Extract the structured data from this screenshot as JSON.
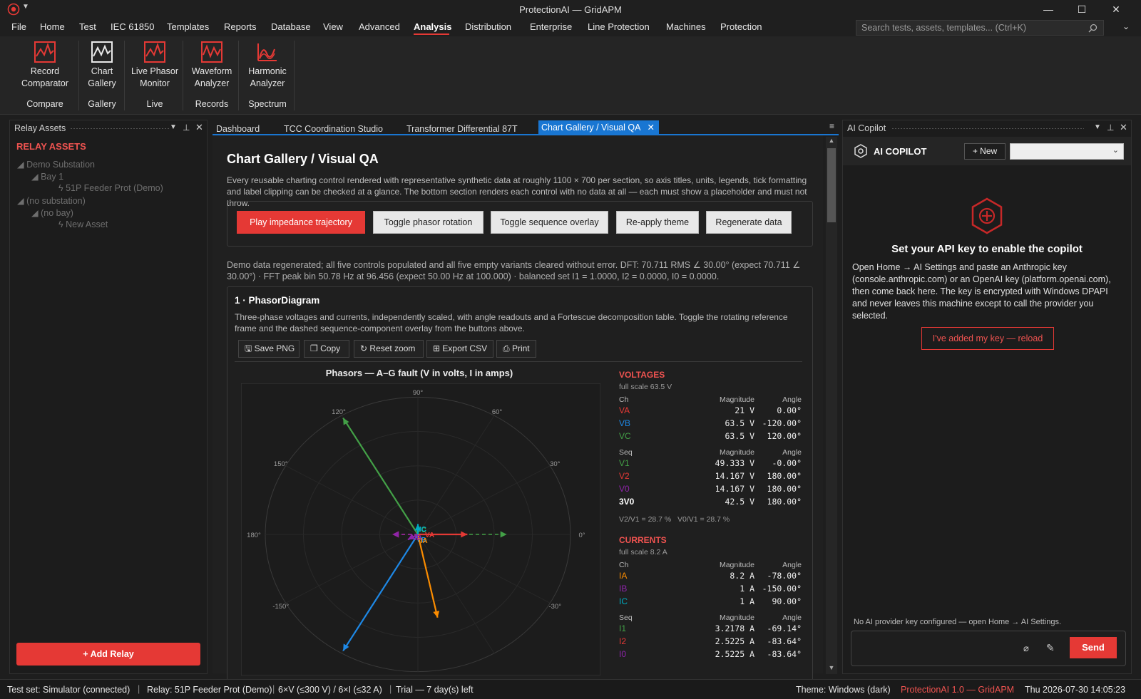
{
  "window": {
    "title": "ProtectionAI — GridAPM"
  },
  "menu": [
    "File",
    "Home",
    "Test",
    "IEC 61850",
    "Templates",
    "Reports",
    "Database",
    "View",
    "Advanced",
    "Analysis",
    "Distribution",
    "Enterprise",
    "Line Protection",
    "Machines",
    "Protection"
  ],
  "search_placeholder": "Search tests, assets, templates... (Ctrl+K)",
  "ribbon": {
    "buttons": [
      {
        "l1": "Record",
        "l2": "Comparator"
      },
      {
        "l1": "Chart",
        "l2": "Gallery"
      },
      {
        "l1": "Live Phasor",
        "l2": "Monitor"
      },
      {
        "l1": "Waveform",
        "l2": "Analyzer"
      },
      {
        "l1": "Harmonic",
        "l2": "Analyzer"
      }
    ],
    "groups": [
      "Compare",
      "Gallery",
      "Live",
      "Records",
      "Spectrum"
    ]
  },
  "left": {
    "title": "Relay Assets",
    "heading": "RELAY ASSETS",
    "tree": [
      "Demo Substation",
      "Bay 1",
      "51P Feeder Prot (Demo)",
      "(no substation)",
      "(no bay)",
      "New Asset"
    ],
    "add": "+ Add Relay"
  },
  "tabs": [
    "Dashboard",
    "TCC Coordination Studio",
    "Transformer Differential 87T",
    "Chart Gallery / Visual QA"
  ],
  "doc": {
    "title": "Chart Gallery / Visual QA",
    "desc": "Every reusable charting control rendered with representative synthetic data at roughly 1100 × 700 per section, so axis titles, units, legends, tick formatting and label clipping can be checked at a glance. The bottom section renders each control with no data at all — each must show a placeholder and must not throw.",
    "buttons": [
      "Play impedance trajectory",
      "Toggle phasor rotation",
      "Toggle sequence overlay",
      "Re-apply theme",
      "Regenerate data"
    ],
    "status": "Demo data regenerated; all five controls populated and all five empty variants cleared without error.  DFT: 70.711 RMS ∠ 30.00° (expect 70.711 ∠ 30.00°) · FFT peak bin 50.78 Hz at 96.456 (expect 50.00 Hz at 100.000) · balanced set I1 = 1.0000, I2 = 0.0000, I0 = 0.0000.",
    "section_title": "1 · PhasorDiagram",
    "section_desc": "Three-phase voltages and currents, independently scaled, with angle readouts and a Fortescue decomposition table. Toggle the rotating reference frame and the dashed sequence-component overlay from the buttons above.",
    "tools": [
      "Save PNG",
      "Copy",
      "Reset zoom",
      "Export CSV",
      "Print"
    ]
  },
  "chart_data": {
    "type": "phasor",
    "title": "Phasors — A–G fault (V in volts, I in amps)",
    "angle_labels": [
      "90°",
      "60°",
      "30°",
      "0°",
      "-30°",
      "-150°",
      "180°",
      "150°",
      "120°"
    ],
    "phasors": [
      {
        "name": "VA",
        "mag": 21,
        "angle": 0,
        "color": "#e53935"
      },
      {
        "name": "VB",
        "mag": 63.5,
        "angle": -120,
        "color": "#1e88e5"
      },
      {
        "name": "VC",
        "mag": 63.5,
        "angle": 120,
        "color": "#43a047"
      },
      {
        "name": "IA",
        "mag": 8.2,
        "angle": -78,
        "color": "#fb8c00"
      },
      {
        "name": "IB",
        "mag": 1,
        "angle": -150,
        "color": "#8e24aa"
      },
      {
        "name": "IC",
        "mag": 1,
        "angle": 90,
        "color": "#00acc1"
      }
    ],
    "seq_overlay": [
      {
        "name": "V1",
        "mag": 49.333,
        "angle": 0,
        "color": "#43a047"
      },
      {
        "name": "V2",
        "mag": 14.167,
        "angle": 180,
        "color": "#e53935"
      },
      {
        "name": "V0",
        "mag": 14.167,
        "angle": 180,
        "color": "#8e24aa"
      }
    ],
    "voltages": {
      "heading": "VOLTAGES",
      "scale": "full scale 63.5 V",
      "ch": [
        [
          "VA",
          "21 V",
          "0.00°",
          "#e53935"
        ],
        [
          "VB",
          "63.5 V",
          "-120.00°",
          "#1e88e5"
        ],
        [
          "VC",
          "63.5 V",
          "120.00°",
          "#43a047"
        ]
      ],
      "seq": [
        [
          "V1",
          "49.333 V",
          "-0.00°",
          "#43a047"
        ],
        [
          "V2",
          "14.167 V",
          "180.00°",
          "#e53935"
        ],
        [
          "V0",
          "14.167 V",
          "180.00°",
          "#8e24aa"
        ],
        [
          "3V0",
          "42.5 V",
          "180.00°",
          "#ffffff"
        ]
      ],
      "ratio": "V2/V1 = 28.7 %   V0/V1 = 28.7 %"
    },
    "currents": {
      "heading": "CURRENTS",
      "scale": "full scale 8.2 A",
      "ch": [
        [
          "IA",
          "8.2 A",
          "-78.00°",
          "#fb8c00"
        ],
        [
          "IB",
          "1 A",
          "-150.00°",
          "#8e24aa"
        ],
        [
          "IC",
          "1 A",
          "90.00°",
          "#00acc1"
        ]
      ],
      "seq": [
        [
          "I1",
          "3.2178 A",
          "-69.14°",
          "#43a047"
        ],
        [
          "I2",
          "2.5225 A",
          "-83.64°",
          "#e53935"
        ],
        [
          "I0",
          "2.5225 A",
          "-83.64°",
          "#8e24aa"
        ]
      ]
    }
  },
  "copilot": {
    "title": "AI Copilot",
    "brand": "AI COPILOT",
    "new": "+ New",
    "heading": "Set your API key to enable the copilot",
    "body": "Open Home → AI Settings and paste an Anthropic key (console.anthropic.com) or an OpenAI key (platform.openai.com), then come back here. The key is encrypted with Windows DPAPI and never leaves this machine except to call the provider you selected.",
    "reload": "I've added my key — reload",
    "footer": "No AI provider key configured — open Home → AI Settings.",
    "send": "Send"
  },
  "status": {
    "testset": "Test set: Simulator (connected)",
    "relay": "Relay: 51P Feeder Prot (Demo)",
    "ranges": "6×V (≤300 V) / 6×I (≤32 A)",
    "trial": "Trial — 7 day(s) left",
    "theme": "Theme: Windows (dark)",
    "brand": "ProtectionAI 1.0 — GridAPM",
    "clock": "Thu 2026-07-30 14:05:23"
  }
}
